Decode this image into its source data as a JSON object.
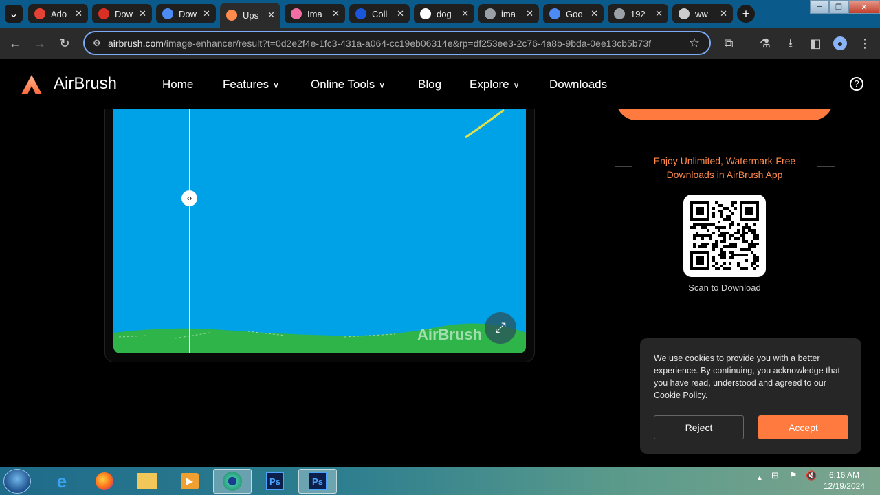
{
  "browser": {
    "tabs": [
      {
        "title": "Ado",
        "favicon": "red-circle-icon",
        "color": "#e34234"
      },
      {
        "title": "Dow",
        "favicon": "gmail-icon",
        "color": "#d93025"
      },
      {
        "title": "Dow",
        "favicon": "download-icon",
        "color": "#4c8bf5"
      },
      {
        "title": "Ups",
        "favicon": "airbrush-icon",
        "color": "#ff8a4c"
      },
      {
        "title": "Ima",
        "favicon": "octopus-icon",
        "color": "#f36fa3"
      },
      {
        "title": "Coll",
        "favicon": "search-icon",
        "color": "#1a56db"
      },
      {
        "title": "dog",
        "favicon": "google-icon",
        "color": "#ffffff"
      },
      {
        "title": "ima",
        "favicon": "globe-icon",
        "color": "#9aa0a6"
      },
      {
        "title": "Goo",
        "favicon": "google-lens-icon",
        "color": "#4c8bf5"
      },
      {
        "title": "192",
        "favicon": "globe-icon",
        "color": "#9aa0a6"
      },
      {
        "title": "ww",
        "favicon": "loading-spinner-icon",
        "color": "#cccccc"
      }
    ],
    "active_tab_index": 3,
    "address": {
      "host": "airbrush.com",
      "path": "/image-enhancer/result?t=0d2e2f4e-1fc3-431a-a064-cc19eb06314e&rp=df253ee3-2c76-4a8b-9bda-0ee13cb5b73f"
    }
  },
  "site": {
    "brand": "AirBrush",
    "brand_color": "#ff7a3f",
    "nav": {
      "home": "Home",
      "features": "Features",
      "online_tools": "Online Tools",
      "blog": "Blog",
      "explore": "Explore",
      "downloads": "Downloads"
    },
    "preview": {
      "watermark": "AirBrush",
      "background_color": "#00a2e7",
      "ground_color": "#2fb44a"
    },
    "promo_line1": "Enjoy Unlimited, Watermark-Free",
    "promo_line2": "Downloads in  AirBrush App",
    "scan_label": "Scan to Download",
    "cookie": {
      "message": "We use cookies to provide you with a better experience. By continuing, you acknowledge that you have read, understood and agreed to our Cookie Policy.",
      "reject": "Reject",
      "accept": "Accept"
    }
  },
  "taskbar": {
    "apps": [
      "start-orb-icon",
      "internet-explorer-icon",
      "firefox-icon",
      "file-explorer-icon",
      "media-player-icon",
      "chrome-icon",
      "photoshop-icon",
      "photoshop-icon"
    ],
    "ps_label": "Ps",
    "time": "6:16 AM",
    "date": "12/19/2024"
  }
}
